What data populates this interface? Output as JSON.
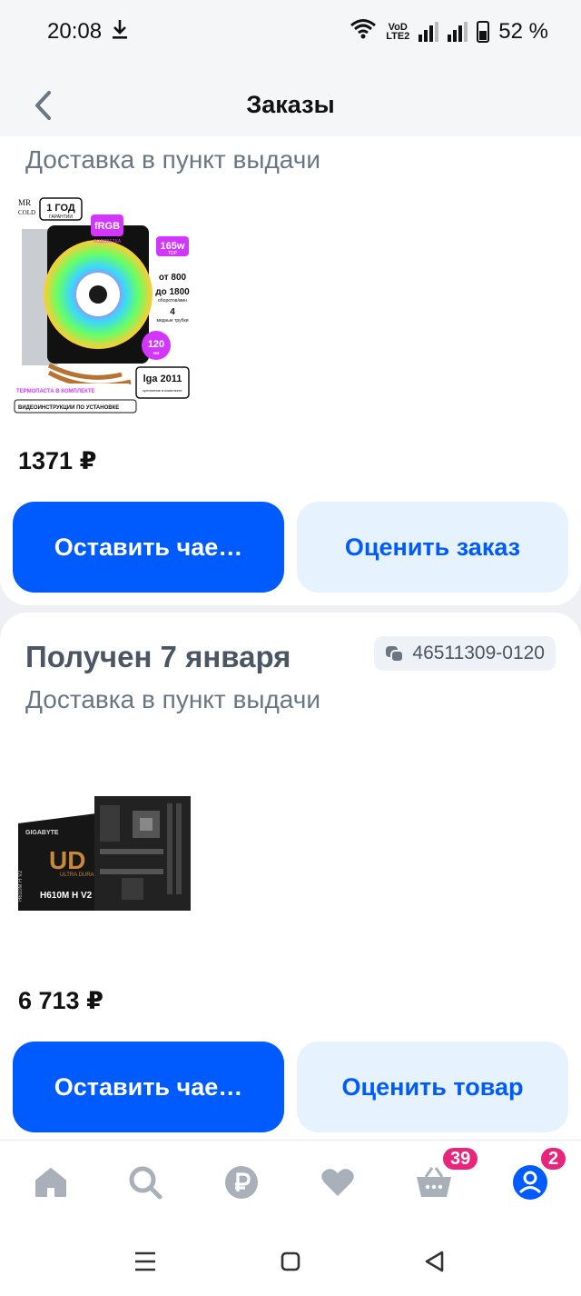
{
  "status_bar": {
    "time": "20:08",
    "network_label_top": "VoD",
    "network_label_bottom": "LTE2",
    "battery": "52 %"
  },
  "header": {
    "title": "Заказы"
  },
  "orders": [
    {
      "delivery": "Доставка в пункт выдачи",
      "price": "1371 ₽",
      "product_image": {
        "brand_top": "MR",
        "brand_bottom": "COLD",
        "warranty": "1 ГОД",
        "warranty_sub": "ГАРАНТИИ",
        "rgb": "fRGB",
        "rgb_sub": "ПОДСВЕТКА",
        "tdp": "165w",
        "tdp_sub": "TDP",
        "rpm_from": "от 800",
        "rpm_to": "до 1800",
        "rpm_sub": "оборотов/мин",
        "pipes": "4",
        "pipes_sub": "медные трубки",
        "fan_size": "120",
        "fan_size_sub": "мм",
        "socket": "lga 2011",
        "socket_sub": "крепление в комплекте",
        "paste": "ТЕРМОПАСТА В КОМПЛЕКТЕ",
        "video": "ВИДЕОИНСТРУКЦИИ ПО УСТАНОВКЕ"
      },
      "primary_button": "Оставить чае…",
      "secondary_button": "Оценить заказ"
    },
    {
      "status": "Получен 7 января",
      "order_number": "46511309-0120",
      "delivery": "Доставка в пункт выдачи",
      "price": "6 713 ₽",
      "product_image": {
        "brand": "GIGABYTE",
        "model": "H610M H V2",
        "series": "ULTRA DURABLE",
        "box_side": "H610M H V2"
      },
      "primary_button": "Оставить чае…",
      "secondary_button": "Оценить товар"
    }
  ],
  "tabbar": {
    "items": [
      {
        "icon": "home-icon"
      },
      {
        "icon": "search-icon"
      },
      {
        "icon": "ruble-icon"
      },
      {
        "icon": "heart-icon"
      },
      {
        "icon": "cart-icon",
        "badge": "39"
      },
      {
        "icon": "profile-icon",
        "badge": "2"
      }
    ]
  },
  "colors": {
    "accent": "#005bff",
    "secondary_bg": "#e6f2fd",
    "badge": "#e8247b"
  }
}
